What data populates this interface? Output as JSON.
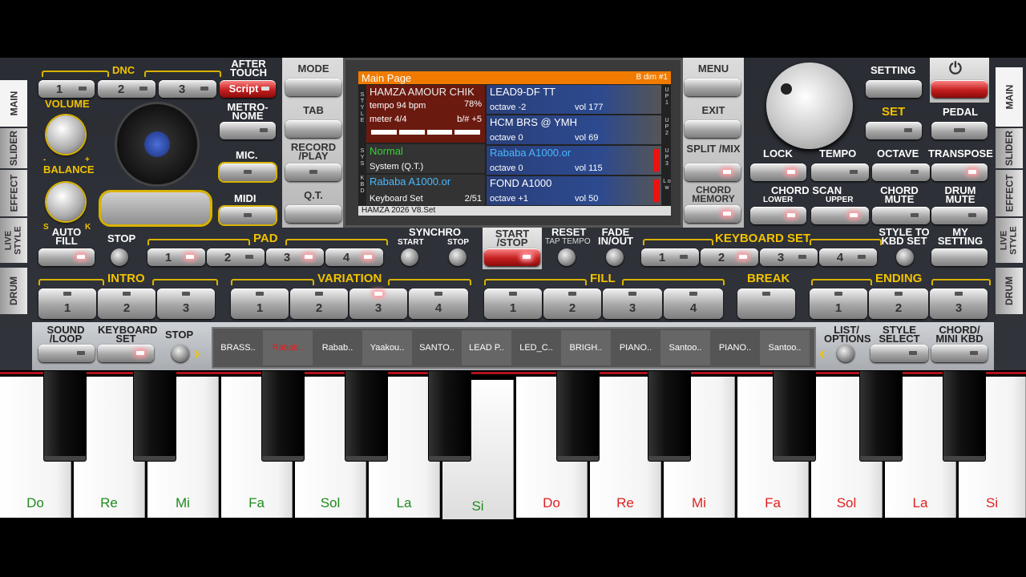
{
  "left_tabs": [
    "MAIN",
    "SLIDER",
    "EFFECT",
    "LIVE STYLE",
    "DRUM"
  ],
  "right_tabs": [
    "MAIN",
    "SLIDER",
    "EFFECT",
    "LIVE STYLE",
    "DRUM"
  ],
  "dnc": {
    "label": "DNC",
    "buttons": [
      "1",
      "2",
      "3"
    ],
    "script": "Script",
    "after_touch": "AFTER TOUCH"
  },
  "volume": "VOLUME",
  "balance": "BALANCE",
  "balance_minus": "-",
  "balance_plus": "+",
  "balance_s": "S",
  "balance_k": "K",
  "metronome": "METRO- NOME",
  "mic": "MIC.",
  "midi": "MIDI",
  "mode": "MODE",
  "tab": "TAB",
  "record_play": "RECORD /PLAY",
  "qt": "Q.T.",
  "menu": "MENU",
  "exit": "EXIT",
  "split_mix": "SPLIT /MIX",
  "chord_memory": "CHORD MEMORY",
  "setting": "SETTING",
  "power_icon": "⏻",
  "set": "SET",
  "pedal": "PEDAL",
  "lock": "LOCK",
  "tempo": "TEMPO",
  "octave": "OCTAVE",
  "transpose": "TRANSPOSE",
  "chord_scan": "CHORD SCAN",
  "lower": "LOWER",
  "upper": "UPPER",
  "chord_mute": "CHORD MUTE",
  "drum_mute": "DRUM MUTE",
  "screen": {
    "header": "Main Page",
    "chord": "B dim #1",
    "style_name": "HAMZA AMOUR CHIK",
    "tempo": "tempo 94 bpm",
    "style_vol": "78%",
    "meter": "meter 4/4",
    "bass": "b/# +5",
    "sys_name": "Normal",
    "sys_sub": "System (Q.T.)",
    "kbd_name": "Rababa A1000.or",
    "kbd_sub": "Keyboard Set",
    "kbd_count": "2/51",
    "footer": "HAMZA 2026 V8.Set",
    "left_labels": [
      "S T Y L E",
      "S Y S",
      "K B D"
    ],
    "parts": [
      {
        "name": "LEAD9-DF TT",
        "octave": "octave -2",
        "vol": "vol 177",
        "tag": "U P 1"
      },
      {
        "name": "HCM BRS @ YMH",
        "octave": "octave  0",
        "vol": "vol 69",
        "tag": "U P 2"
      },
      {
        "name": "Rababa A1000.or",
        "octave": "octave  0",
        "vol": "vol 115",
        "tag": "U P 3"
      },
      {
        "name": "FOND A1000",
        "octave": "octave +1",
        "vol": "vol 50",
        "tag": "L o w"
      }
    ]
  },
  "auto_fill": "AUTO FILL",
  "stop": "STOP",
  "pad": {
    "label": "PAD",
    "buttons": [
      "1",
      "2",
      "3",
      "4"
    ]
  },
  "synchro": "SYNCHRO",
  "sync_start": "START",
  "sync_stop": "STOP",
  "start_stop": "START /STOP",
  "reset": "RESET",
  "tap_tempo": "TAP TEMPO",
  "fade": "FADE IN/OUT",
  "keyboard_set": {
    "label": "KEYBOARD SET",
    "buttons": [
      "1",
      "2",
      "3",
      "4"
    ]
  },
  "style_to_kbd": "STYLE TO KBD SET",
  "my_setting": "MY SETTING",
  "intro": {
    "label": "INTRO",
    "buttons": [
      "1",
      "2",
      "3"
    ]
  },
  "variation": {
    "label": "VARIATION",
    "buttons": [
      "1",
      "2",
      "3",
      "4"
    ]
  },
  "fill": {
    "label": "FILL",
    "buttons": [
      "1",
      "2",
      "3",
      "4"
    ]
  },
  "break": "BREAK",
  "ending": {
    "label": "ENDING",
    "buttons": [
      "1",
      "2",
      "3"
    ]
  },
  "sound_loop": "SOUND /LOOP",
  "keyboard_set2": "KEYBOARD SET",
  "stop2": "STOP",
  "list_options": "LIST/ OPTIONS",
  "style_select": "STYLE SELECT",
  "chord_mini": "CHORD/ MINI KBD",
  "sounds": [
    "BRASS..",
    "Rabab..",
    "Rabab..",
    "Yaakou..",
    "SANTO..",
    "LEAD P..",
    "LED_C..",
    "BRIGH..",
    "PIANO..",
    "Santoo..",
    "PIANO..",
    "Santoo.."
  ],
  "keys": [
    {
      "n": "Do",
      "c": "#1f8a1f"
    },
    {
      "n": "Re",
      "c": "#1f8a1f"
    },
    {
      "n": "Mi",
      "c": "#1f8a1f"
    },
    {
      "n": "Fa",
      "c": "#1f8a1f"
    },
    {
      "n": "Sol",
      "c": "#1f8a1f"
    },
    {
      "n": "La",
      "c": "#1f8a1f"
    },
    {
      "n": "Si",
      "c": "#1f8a1f"
    },
    {
      "n": "Do",
      "c": "#e02020"
    },
    {
      "n": "Re",
      "c": "#e02020"
    },
    {
      "n": "Mi",
      "c": "#e02020"
    },
    {
      "n": "Fa",
      "c": "#e02020"
    },
    {
      "n": "Sol",
      "c": "#e02020"
    },
    {
      "n": "La",
      "c": "#e02020"
    },
    {
      "n": "Si",
      "c": "#e02020"
    }
  ]
}
